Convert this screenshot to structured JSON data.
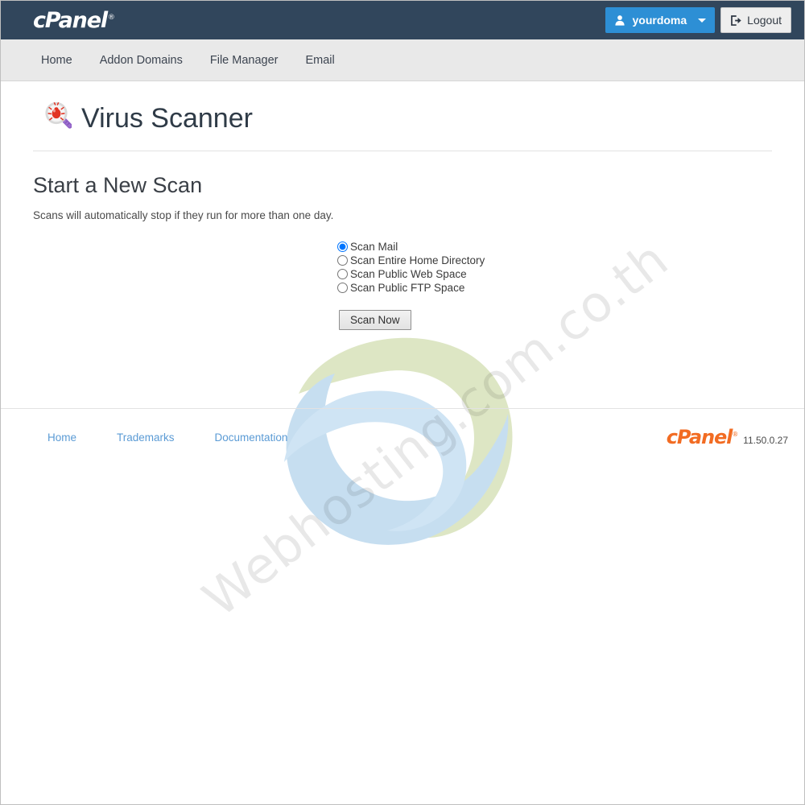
{
  "header": {
    "brand": "cPanel",
    "brand_mark": "®",
    "user_button": {
      "label": "yourdoma",
      "icon": "user-icon",
      "caret_icon": "chevron-down-icon",
      "color": "#2d8fd5"
    },
    "logout_button": {
      "label": "Logout",
      "icon": "sign-out-icon"
    },
    "background_color": "#31465c"
  },
  "nav": {
    "items": [
      {
        "label": "Home"
      },
      {
        "label": "Addon Domains"
      },
      {
        "label": "File Manager"
      },
      {
        "label": "Email"
      }
    ],
    "background_color": "#e9e9e9"
  },
  "page": {
    "title": "Virus Scanner",
    "title_icon": "magnifier-virus-icon",
    "section_title": "Start a New Scan",
    "section_description": "Scans will automatically stop if they run for more than one day."
  },
  "scan_form": {
    "options": [
      {
        "label": "Scan Mail",
        "value": "mail",
        "selected": true
      },
      {
        "label": "Scan Entire Home Directory",
        "value": "home",
        "selected": false
      },
      {
        "label": "Scan Public Web Space",
        "value": "web",
        "selected": false
      },
      {
        "label": "Scan Public FTP Space",
        "value": "ftp",
        "selected": false
      }
    ],
    "submit_label": "Scan Now"
  },
  "footer": {
    "links": [
      {
        "label": "Home"
      },
      {
        "label": "Trademarks"
      },
      {
        "label": "Documentation"
      }
    ],
    "brand": "cPanel",
    "brand_mark": "®",
    "version": "11.50.0.27",
    "link_color": "#5b9bd5",
    "brand_color": "#f26c23"
  },
  "watermark": {
    "text": "Webhosting.com.co.th",
    "swirl_green": "#dbe5c0",
    "swirl_blue": "#c3ddef"
  }
}
